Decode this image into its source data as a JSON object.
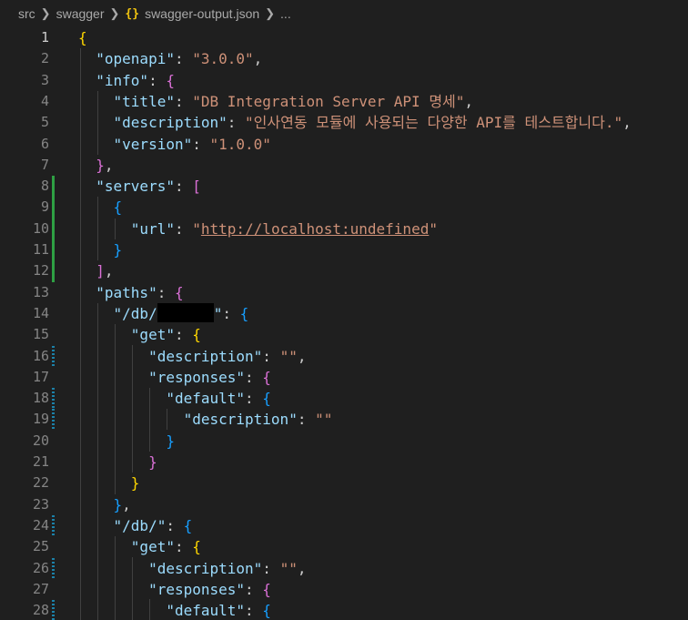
{
  "breadcrumb": {
    "folder1": "src",
    "folder2": "swagger",
    "file_icon": "{}",
    "file": "swagger-output.json",
    "ellipsis": "..."
  },
  "editor": {
    "lines": [
      {
        "n": "1"
      },
      {
        "n": "2"
      },
      {
        "n": "3"
      },
      {
        "n": "4"
      },
      {
        "n": "5"
      },
      {
        "n": "6"
      },
      {
        "n": "7"
      },
      {
        "n": "8"
      },
      {
        "n": "9"
      },
      {
        "n": "10"
      },
      {
        "n": "11"
      },
      {
        "n": "12"
      },
      {
        "n": "13"
      },
      {
        "n": "14"
      },
      {
        "n": "15"
      },
      {
        "n": "16"
      },
      {
        "n": "17"
      },
      {
        "n": "18"
      },
      {
        "n": "19"
      },
      {
        "n": "20"
      },
      {
        "n": "21"
      },
      {
        "n": "22"
      },
      {
        "n": "23"
      },
      {
        "n": "24"
      },
      {
        "n": "25"
      },
      {
        "n": "26"
      },
      {
        "n": "27"
      },
      {
        "n": "28"
      }
    ],
    "tokens": {
      "openapi_key": "\"openapi\"",
      "openapi_val": "\"3.0.0\"",
      "info_key": "\"info\"",
      "title_key": "\"title\"",
      "title_val": "\"DB Integration Server API 명세\"",
      "description_key": "\"description\"",
      "description_val": "\"인사연동 모듈에 사용되는 다양한 API를 테스트합니다.\"",
      "version_key": "\"version\"",
      "version_val": "\"1.0.0\"",
      "servers_key": "\"servers\"",
      "url_key": "\"url\"",
      "url_val": "http://localhost:undefined",
      "paths_key": "\"paths\"",
      "path1_prefix": "\"/db/",
      "path1_suffix": "\"",
      "get_key": "\"get\"",
      "empty_str": "\"\"",
      "responses_key": "\"responses\"",
      "default_key": "\"default\"",
      "path2_key": "\"/db/\""
    },
    "colors": {
      "background": "#1f1f1f",
      "key": "#9cdcfe",
      "string": "#ce9178",
      "bracket_level1": "#ffd700",
      "bracket_level2": "#da70d6",
      "bracket_level3": "#179fff",
      "git_added": "#2ea043",
      "git_modified": "#1b81a8"
    }
  }
}
